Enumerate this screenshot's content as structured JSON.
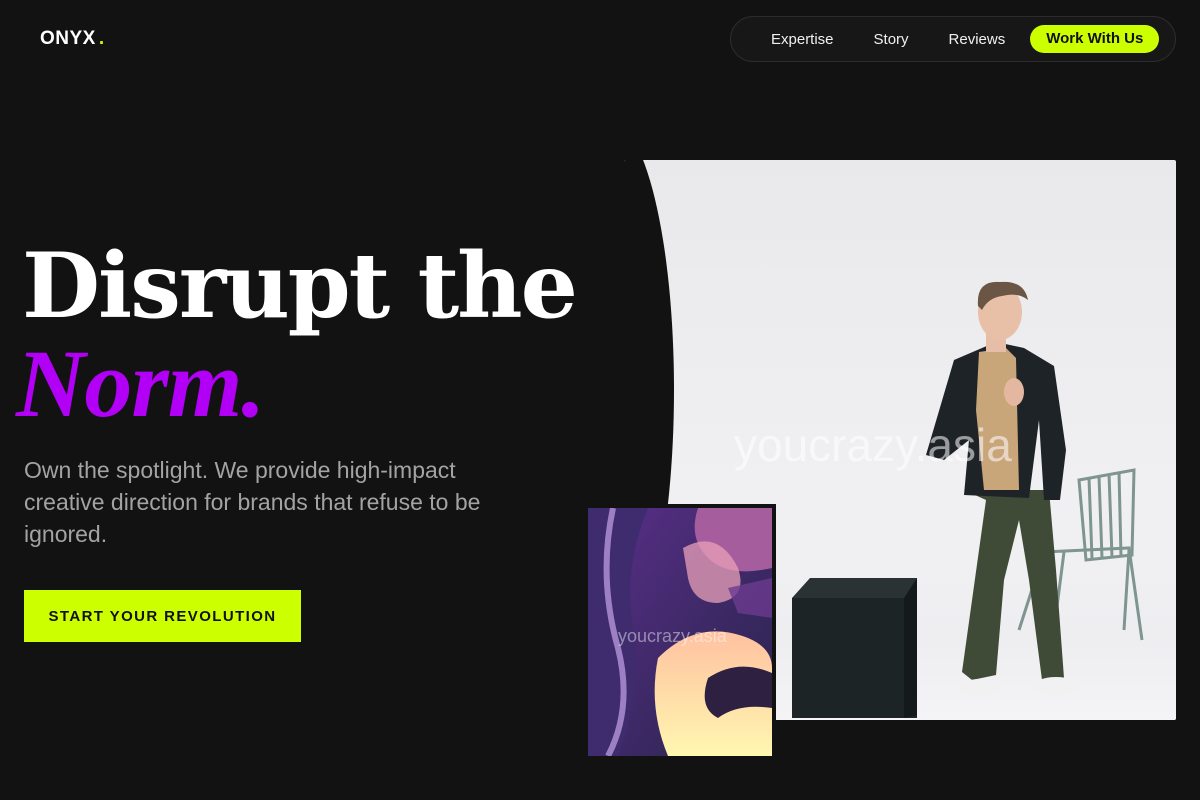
{
  "brand": {
    "name": "ONYX",
    "dot": ".",
    "accent": "#ccff00"
  },
  "nav": {
    "items": [
      {
        "label": "Expertise"
      },
      {
        "label": "Story"
      },
      {
        "label": "Reviews"
      }
    ],
    "cta_label": "Work With Us"
  },
  "hero": {
    "headline": "Disrupt the",
    "headline_accent": "Norm.",
    "accent_color": "#b100f5",
    "subtitle": "Own the spotlight. We provide high-impact creative direction for brands that refuse to be ignored.",
    "button_label": "START YOUR REVOLUTION"
  },
  "images": {
    "main_watermark": "youcrazy.asia",
    "art_watermark": "youcrazy.asia"
  }
}
